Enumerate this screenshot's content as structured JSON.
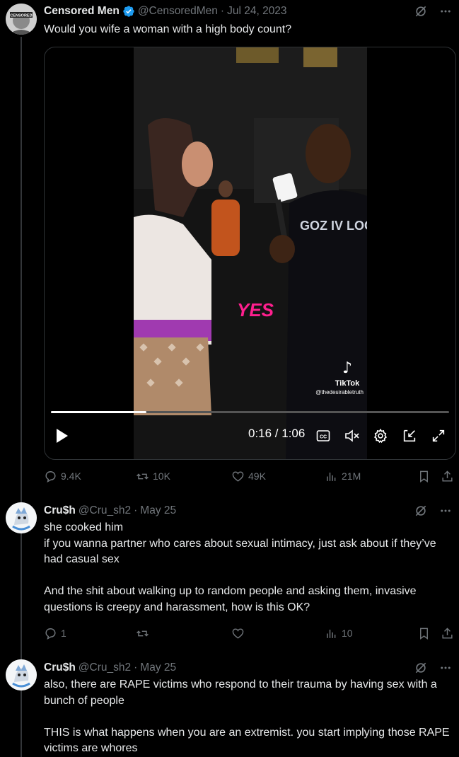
{
  "main_tweet": {
    "name": "Censored Men",
    "handle": "@CensoredMen",
    "separator": "·",
    "date": "Jul 24, 2023",
    "text": "Would you wife a woman with a high body count?",
    "avatar_label": "CENSORED",
    "verified": true,
    "video": {
      "overlay_text": "YES",
      "watermark": "TikTok",
      "watermark_handle": "@thedesirabletruth",
      "time": "0:16 / 1:06",
      "progress": 0.24,
      "cc_label": "CC",
      "shirt_text": "GOZ IV LOGS"
    },
    "actions": {
      "replies": "9.4K",
      "reposts": "10K",
      "likes": "49K",
      "views": "21M"
    }
  },
  "replies": [
    {
      "name": "Cru$h",
      "handle": "@Cru_sh2",
      "separator": "·",
      "date": "May 25",
      "text": "she cooked him\nif you wanna partner who cares about sexual intimacy, just ask about if they’ve had casual sex\n\nAnd the shit about walking up to random people and asking them, invasive questions is creepy and harassment, how is this OK?",
      "actions": {
        "replies": "1",
        "views": "10"
      }
    },
    {
      "name": "Cru$h",
      "handle": "@Cru_sh2",
      "separator": "·",
      "date": "May 25",
      "text": "also, there are RAPE victims who respond to their trauma by having sex with a bunch of people\n\nTHIS is what happens when you are an extremist. you start implying those RAPE victims are whores"
    }
  ],
  "colors": {
    "background": "#000000",
    "text": "#e7e9ea",
    "muted": "#71767b",
    "verified": "#1d9bf0",
    "overlay_pink": "#ff1f8e"
  }
}
